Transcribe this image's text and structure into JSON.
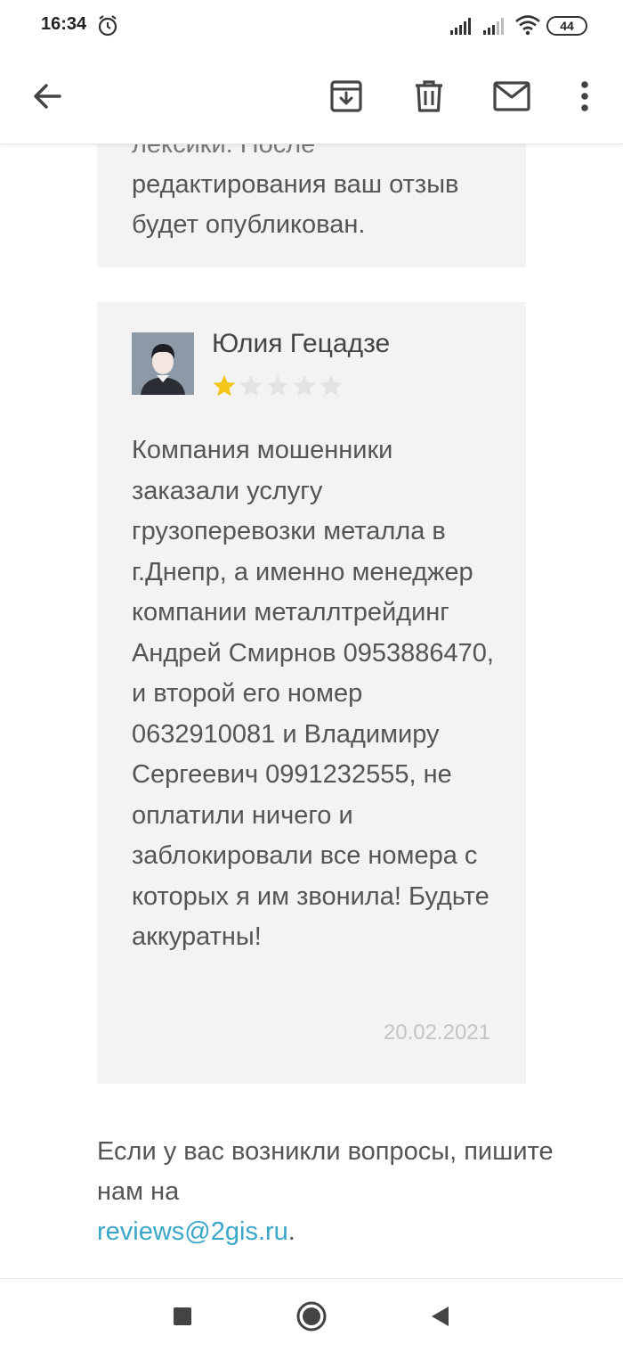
{
  "status_bar": {
    "time": "16:34",
    "battery": "44",
    "icons": [
      "alarm-icon",
      "signal-icon",
      "signal-icon",
      "wifi-icon",
      "battery-icon"
    ]
  },
  "app_bar": {
    "icons": [
      "back-arrow-icon",
      "archive-icon",
      "delete-icon",
      "mail-icon",
      "more-vert-icon"
    ]
  },
  "previous_card": {
    "text_partial": "лексики. После",
    "text": "редактирования ваш отзыв будет опубликован."
  },
  "review": {
    "author": "Юлия Гецадзе",
    "rating": 1,
    "max_rating": 5,
    "star_color": "#f5c518",
    "star_empty_color": "#e3e3e3",
    "text": "Компания мошенники заказали услугу грузоперевозки металла в г.Днепр, а именно менеджер компании металлтрейдинг Андрей Смирнов 0953886470, и второй его номер 0632910081 и Владимиру Сергеевич 0991232555, не оплатили ничего и заблокировали все номера с которых я им звонила! Будьте аккуратны!",
    "date": "20.02.2021"
  },
  "footer": {
    "text": "Если у вас возникли вопросы, пишите нам на",
    "email": "reviews@2gis.ru",
    "suffix": ".",
    "link_color": "#3aa6c8"
  },
  "nav_bar": {
    "icons": [
      "recents-square-icon",
      "home-circle-icon",
      "back-triangle-icon"
    ]
  }
}
